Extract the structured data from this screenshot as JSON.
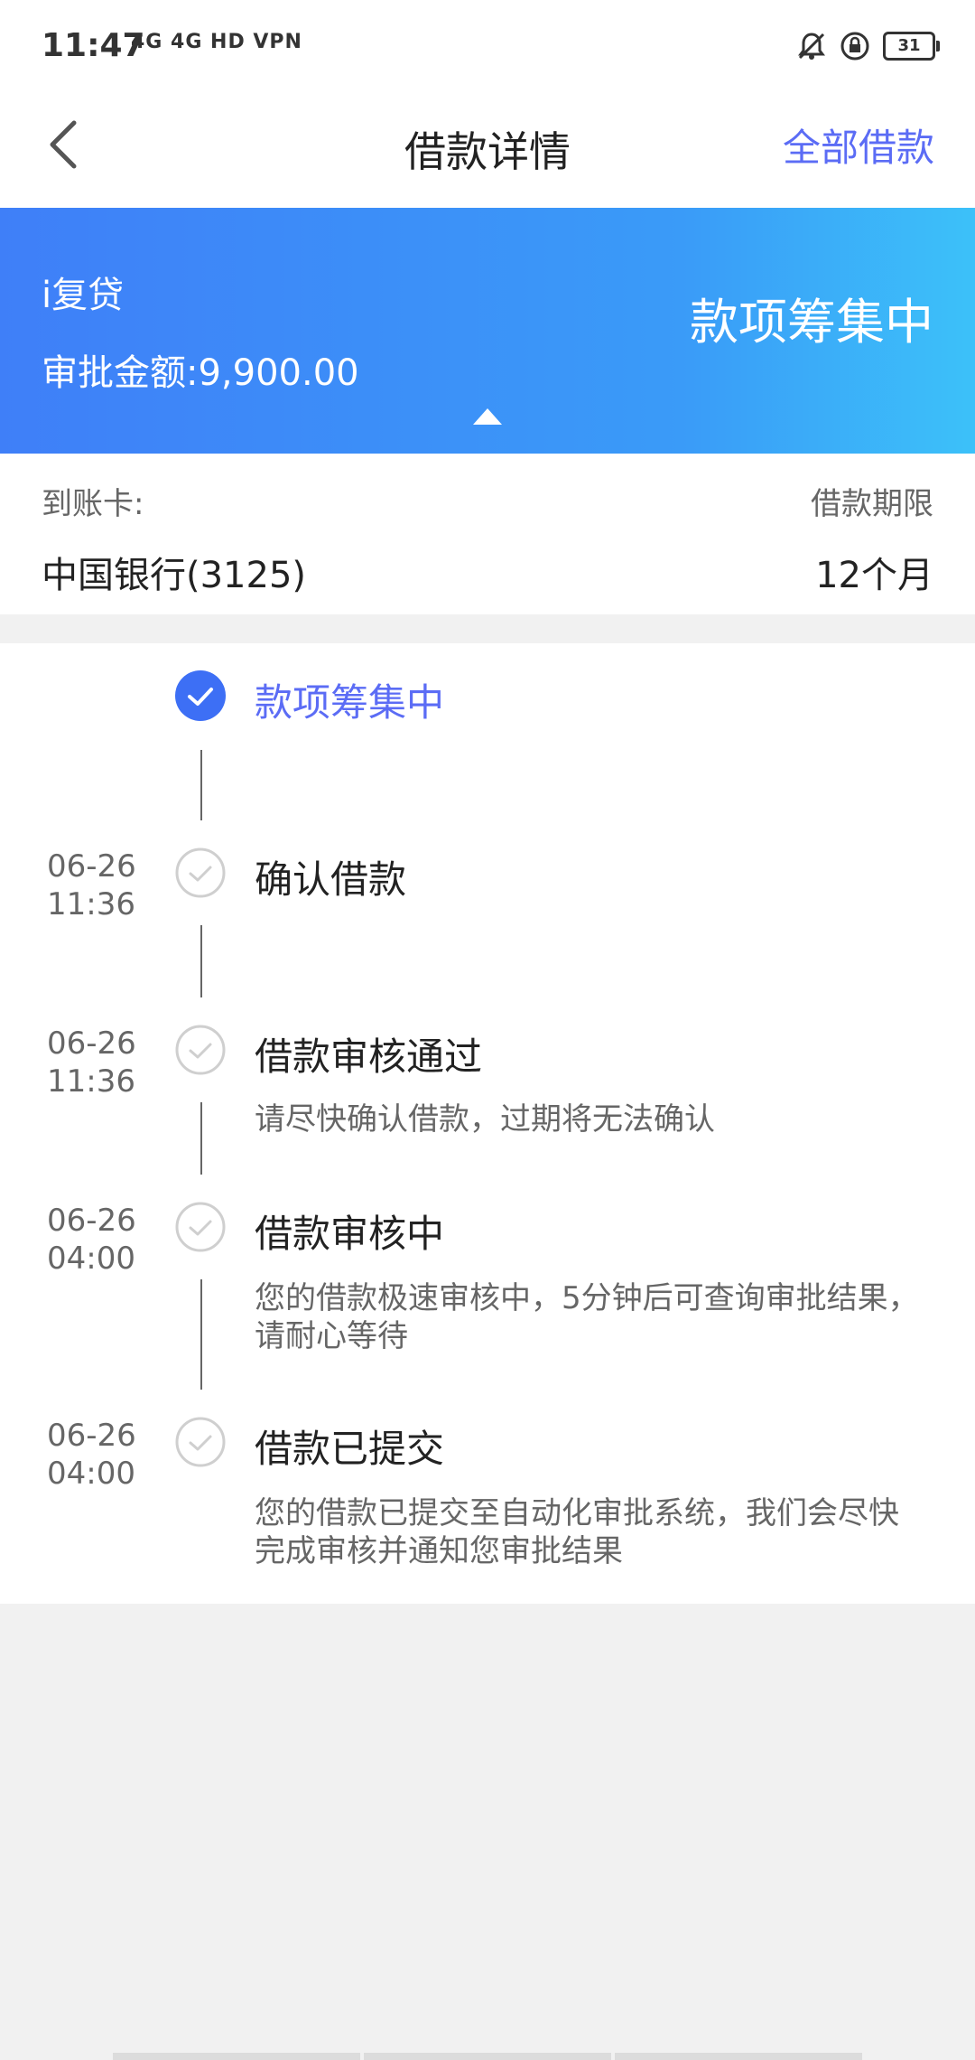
{
  "status_bar": {
    "time": "11:47",
    "network": "4G  4G  HD  VPN",
    "battery": "31"
  },
  "header": {
    "title": "借款详情",
    "right_action": "全部借款"
  },
  "banner": {
    "product": "i复贷",
    "amount_label": "审批金额:9,900.00",
    "status": "款项筹集中",
    "gradient_colors": [
      "#3f7ff8",
      "#3cc1f9"
    ]
  },
  "account": {
    "card_label": "到账卡:",
    "card_value": "中国银行(3125)",
    "term_label": "借款期限",
    "term_value": "12个月"
  },
  "timeline": [
    {
      "date": "",
      "time": "",
      "title": "款项筹集中",
      "desc": "",
      "active": true
    },
    {
      "date": "06-26",
      "time": "11:36",
      "title": "确认借款",
      "desc": "",
      "active": false
    },
    {
      "date": "06-26",
      "time": "11:36",
      "title": "借款审核通过",
      "desc": "请尽快确认借款，过期将无法确认",
      "active": false
    },
    {
      "date": "06-26",
      "time": "04:00",
      "title": "借款审核中",
      "desc": "您的借款极速审核中，5分钟后可查询审批结果，请耐心等待",
      "active": false
    },
    {
      "date": "06-26",
      "time": "04:00",
      "title": "借款已提交",
      "desc": "您的借款已提交至自动化审批系统，我们会尽快完成审核并通知您审批结果",
      "active": false
    }
  ],
  "colors": {
    "accent": "#5b6cf5",
    "check_active": "#3d6ff5"
  }
}
